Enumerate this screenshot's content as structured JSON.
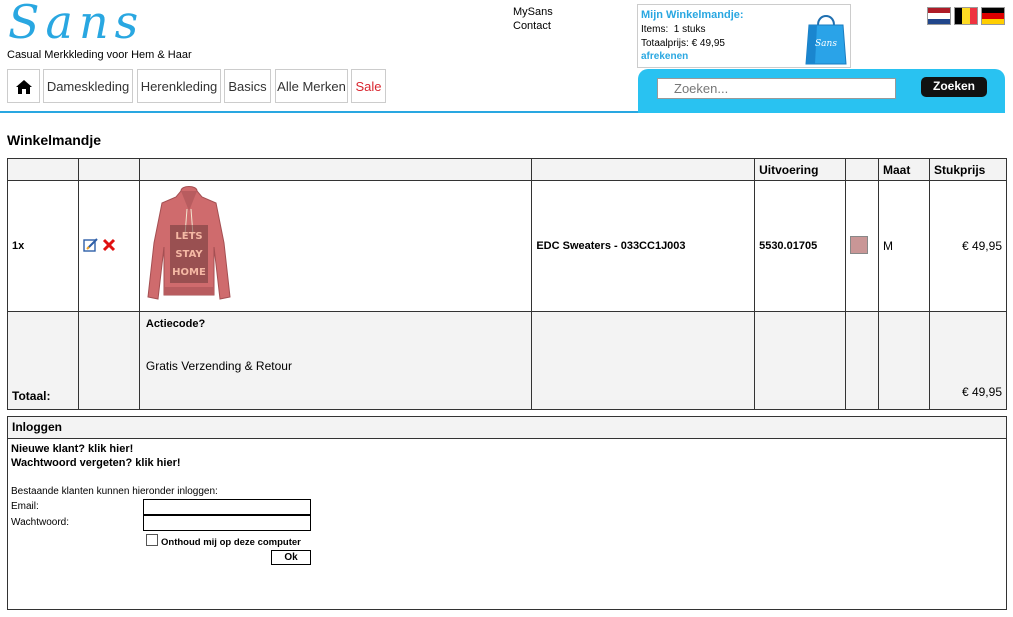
{
  "logo": {
    "text": "Sans",
    "tagline": "Casual Merkkleding voor Hem & Haar"
  },
  "toplinks": [
    "MySans",
    "Contact"
  ],
  "minicart": {
    "title": "Mijn Winkelmandje:",
    "items_label": "Items:",
    "items_value": "1 stuks",
    "total_label": "Totaalprijs:",
    "total_value": "€ 49,95",
    "checkout_label": "afrekenen",
    "bag_logo": "Sans"
  },
  "flags": [
    "netherlands-flag",
    "belgium-flag",
    "germany-flag"
  ],
  "nav": [
    "Dameskleding",
    "Herenkleding",
    "Basics",
    "Alle Merken",
    "Sale"
  ],
  "search": {
    "placeholder": "Zoeken...",
    "button": "Zoeken"
  },
  "page_title": "Winkelmandje",
  "cart": {
    "headers": {
      "uitvoering": "Uitvoering",
      "maat": "Maat",
      "stukprijs": "Stukprijs"
    },
    "item": {
      "qty": "1x",
      "name": "EDC Sweaters - 033CC1J003",
      "uitvoering": "5530.01705",
      "color": "#c99696",
      "size": "M",
      "price": "€ 49,95"
    },
    "totals": {
      "label": "Totaal:",
      "actiecode": "Actiecode?",
      "shipping": "Gratis Verzending & Retour",
      "total": "€ 49,95"
    }
  },
  "login": {
    "header": "Inloggen",
    "new_customer": "Nieuwe klant? klik hier!",
    "forgot": "Wachtwoord vergeten? klik hier!",
    "intro": "Bestaande klanten kunnen hieronder inloggen:",
    "email_label": "Email:",
    "password_label": "Wachtwoord:",
    "remember": "Onthoud mij op deze computer",
    "ok": "Ok"
  },
  "colors": {
    "accent": "#29a7e1",
    "search_panel": "#29c2f1",
    "sale": "#d9262f"
  }
}
